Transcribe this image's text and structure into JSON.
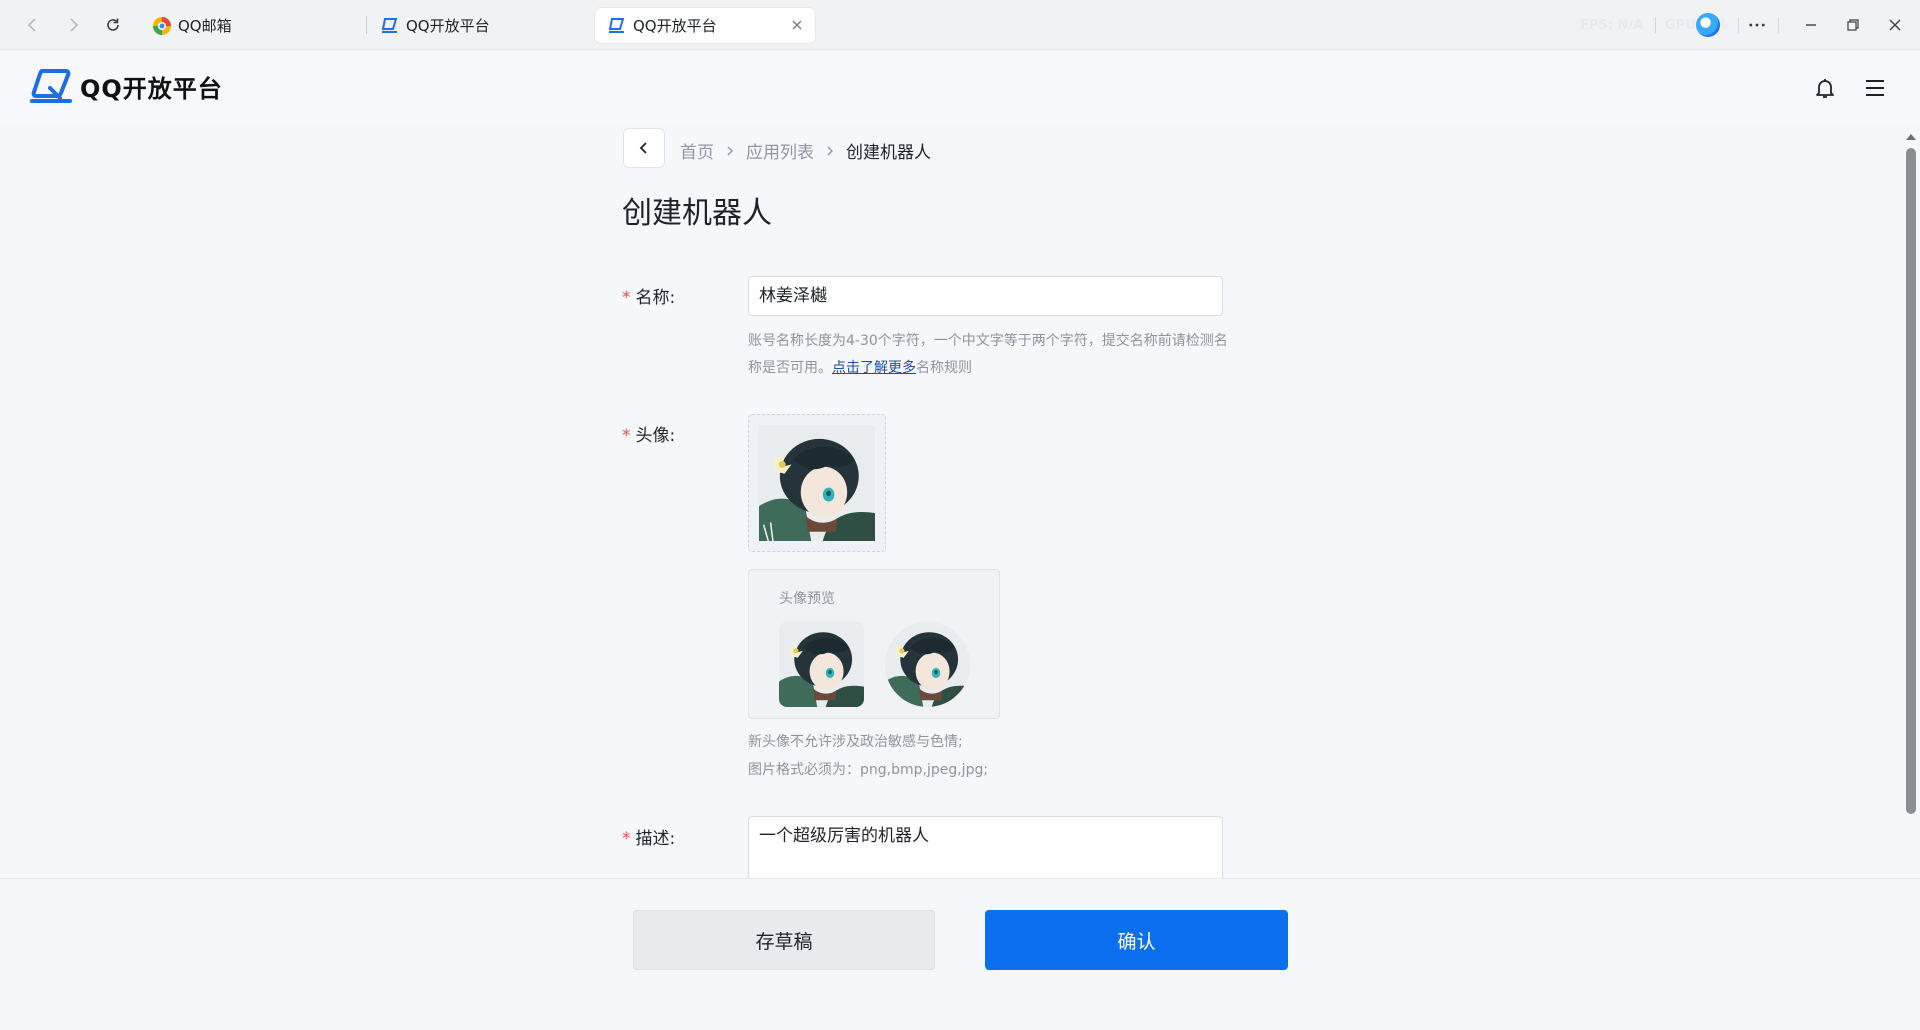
{
  "browser": {
    "tabs": [
      {
        "title": "QQ邮箱",
        "icon": "qqmail-favicon",
        "active": false
      },
      {
        "title": "QQ开放平台",
        "icon": "qq-open-platform-favicon",
        "active": false
      },
      {
        "title": "QQ开放平台",
        "icon": "qq-open-platform-favicon",
        "active": true
      }
    ],
    "stats": {
      "fps": "FPS: N/A",
      "gpu": "GPU: 0%"
    }
  },
  "header": {
    "logo_text": "QQ开放平台",
    "icons": [
      "bell-icon",
      "menu-icon"
    ]
  },
  "breadcrumb": {
    "items": [
      "首页",
      "应用列表",
      "创建机器人"
    ]
  },
  "page_title": "创建机器人",
  "form": {
    "name": {
      "label": "名称:",
      "value": "林姜泽樾",
      "hint_prefix": "账号名称长度为4-30个字符，一个中文字等于两个字符，提交名称前请检测名称是否可用。",
      "hint_link": "点击了解更多",
      "hint_suffix": "名称规则"
    },
    "avatar": {
      "label": "头像:",
      "preview_title": "头像预览",
      "hint_line1": "新头像不允许涉及政治敏感与色情;",
      "hint_line2": "图片格式必须为：png,bmp,jpeg,jpg;"
    },
    "description": {
      "label": "描述:",
      "value": "一个超级厉害的机器人"
    },
    "required_mark": "*"
  },
  "footer": {
    "draft_label": "存草稿",
    "confirm_label": "确认"
  },
  "colors": {
    "primary": "#0b6ff0",
    "required": "#f54a45",
    "link": "#1e4ea8"
  }
}
